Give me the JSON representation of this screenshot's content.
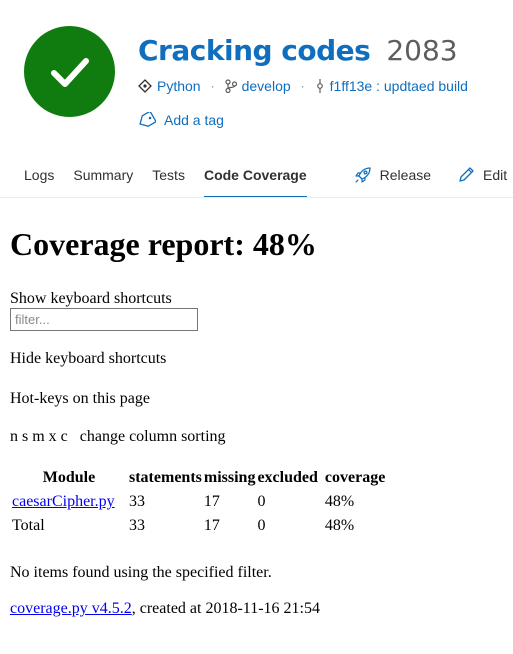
{
  "build": {
    "title": "Cracking codes",
    "number": "2083",
    "status_color": "#107c10",
    "status_icon": "checkmark-icon"
  },
  "meta": {
    "repo_type": "Python",
    "branch": "develop",
    "commit": "f1ff13e : updtaed build"
  },
  "tag_link": "Add a tag",
  "tabs": [
    {
      "label": "Logs"
    },
    {
      "label": "Summary"
    },
    {
      "label": "Tests"
    },
    {
      "label": "Code Coverage",
      "active": true
    }
  ],
  "actions": {
    "release": "Release",
    "edit": "Edit"
  },
  "report": {
    "heading": "Coverage report: 48%",
    "show_shortcuts": "Show keyboard shortcuts",
    "filter_placeholder": "filter...",
    "hide_shortcuts": "Hide keyboard shortcuts",
    "hotkeys": "Hot-keys on this page",
    "sorting": "n s m x c   change column sorting",
    "table": {
      "headers": [
        "Module",
        "statements",
        "missing",
        "excluded",
        "coverage"
      ],
      "rows": [
        [
          "caesarCipher.py",
          "33",
          "17",
          "0",
          "48%"
        ]
      ],
      "total": [
        "Total",
        "33",
        "17",
        "0",
        "48%"
      ]
    },
    "no_items": "No items found using the specified filter.",
    "footer_link": "coverage.py v4.5.2",
    "footer_text": ", created at 2018-11-16 21:54"
  },
  "colors": {
    "accent": "#106ebe",
    "success": "#107c10",
    "link": "#0000ee"
  }
}
